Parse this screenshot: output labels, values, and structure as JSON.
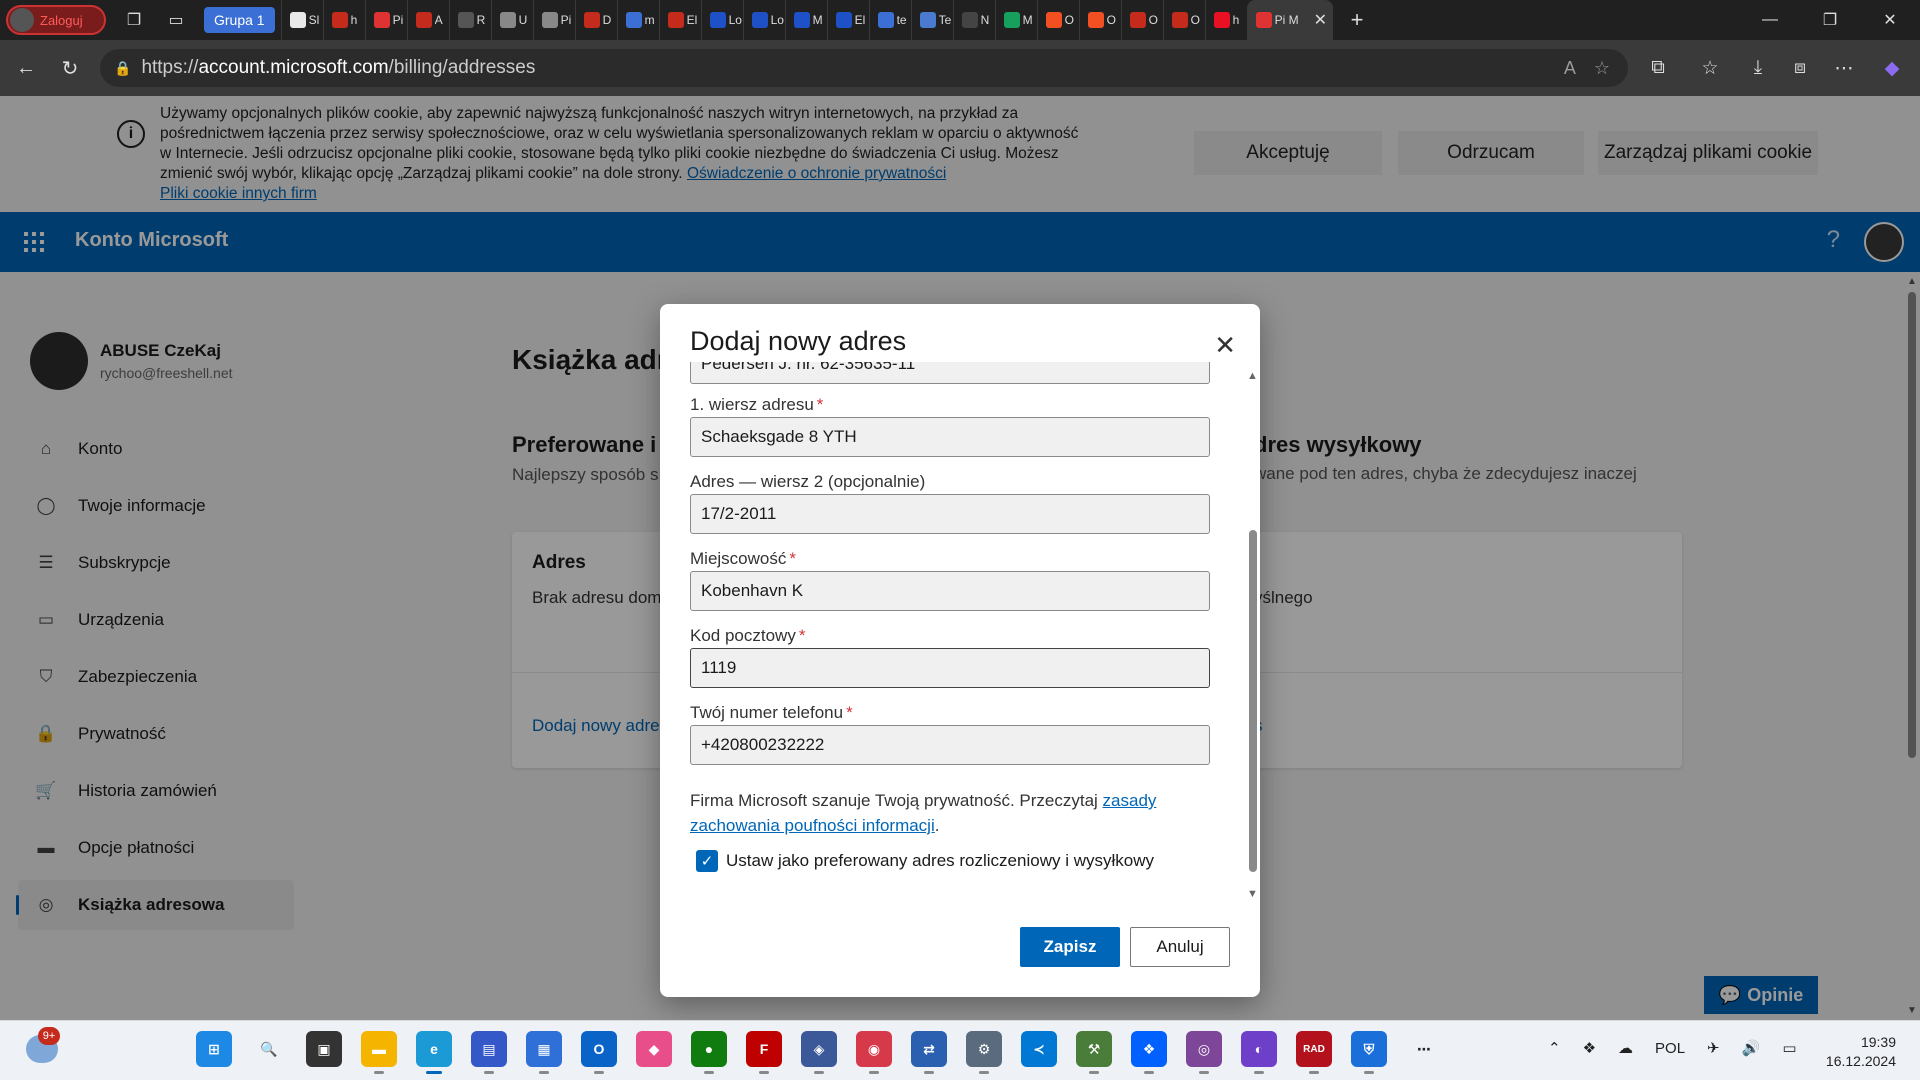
{
  "browser": {
    "profile_label": "Zaloguj",
    "group_label": "Grupa 1",
    "tabs": [
      {
        "title": "Sl",
        "color": "#e8e8e8"
      },
      {
        "title": "h",
        "color": "#c42b1c"
      },
      {
        "title": "Pi",
        "color": "#d33"
      },
      {
        "title": "A",
        "color": "#c42b1c"
      },
      {
        "title": "R",
        "color": "#555"
      },
      {
        "title": "U",
        "color": "#888"
      },
      {
        "title": "Pi",
        "color": "#888"
      },
      {
        "title": "D",
        "color": "#c42b1c"
      },
      {
        "title": "m",
        "color": "#3b6fd6"
      },
      {
        "title": "El",
        "color": "#c42b1c"
      },
      {
        "title": "Lo",
        "color": "#1e50c8"
      },
      {
        "title": "Lo",
        "color": "#1e50c8"
      },
      {
        "title": "M",
        "color": "#1e50c8"
      },
      {
        "title": "El",
        "color": "#1e50c8"
      },
      {
        "title": "te",
        "color": "#3b6fd6"
      },
      {
        "title": "Te",
        "color": "#4a7bd0"
      },
      {
        "title": "N",
        "color": "#444"
      },
      {
        "title": "M",
        "color": "#17a05d"
      },
      {
        "title": "O",
        "color": "#f25022"
      },
      {
        "title": "O",
        "color": "#f25022"
      },
      {
        "title": "O",
        "color": "#c42b1c"
      },
      {
        "title": "O",
        "color": "#c42b1c"
      },
      {
        "title": "h",
        "color": "#e81123"
      }
    ],
    "active_tab_title": "Pi M",
    "url_prefix": "https://",
    "url_host": "account.microsoft.com",
    "url_path": "/billing/addresses"
  },
  "cookie_banner": {
    "text": "Używamy opcjonalnych plików cookie, aby zapewnić najwyższą funkcjonalność naszych witryn internetowych, na przykład za pośrednictwem łączenia przez serwisy społecznościowe, oraz w celu wyświetlania spersonalizowanych reklam w oparciu o aktywność w Internecie. Jeśli odrzucisz opcjonalne pliki cookie, stosowane będą tylko pliki cookie niezbędne do świadczenia Ci usług. Możesz zmienić swój wybór, klikając opcję „Zarządzaj plikami cookie” na dole strony.",
    "privacy_link": "Oświadczenie o ochronie prywatności",
    "third_party_link": "Pliki cookie innych firm",
    "accept_label": "Akceptuję",
    "reject_label": "Odrzucam",
    "manage_label": "Zarządzaj plikami cookie"
  },
  "header": {
    "brand": "Konto Microsoft",
    "help": "?"
  },
  "user": {
    "name": "ABUSE CzeKaj",
    "email": "rychoo@freeshell.net"
  },
  "sidebar": {
    "items": [
      {
        "label": "Konto",
        "icon": "home-icon"
      },
      {
        "label": "Twoje informacje",
        "icon": "person-icon"
      },
      {
        "label": "Subskrypcje",
        "icon": "subscriptions-icon"
      },
      {
        "label": "Urządzenia",
        "icon": "devices-icon"
      },
      {
        "label": "Zabezpieczenia",
        "icon": "shield-icon"
      },
      {
        "label": "Prywatność",
        "icon": "lock-icon"
      },
      {
        "label": "Historia zamówień",
        "icon": "cart-icon"
      },
      {
        "label": "Opcje płatności",
        "icon": "card-icon"
      },
      {
        "label": "Książka adresowa",
        "icon": "location-icon"
      }
    ]
  },
  "main": {
    "title": "Książka adresowa",
    "left_section_title": "Preferowane i",
    "left_section_desc": "Najlepszy sposób s rozliczeniowych",
    "right_section_title": "dres wysyłkowy",
    "right_section_desc": "wane pod ten adres, chyba że zdecydujesz inaczej",
    "left_card_title": "Adres",
    "left_card_text": "Brak adresu dom",
    "left_card_link": "Dodaj nowy adre",
    "right_card_text": "yślnego",
    "right_card_link": "s",
    "feedback_label": "Opinie"
  },
  "dialog": {
    "title": "Dodaj nowy adres",
    "fields": {
      "name_value": "Pedersen J. nr. 62-35635-11",
      "address1_label": "1. wiersz adresu",
      "address1_value": "Schaeksgade 8 YTH",
      "address2_label": "Adres — wiersz 2 (opcjonalnie)",
      "address2_value": "17/2-2011",
      "city_label": "Miejscowość",
      "city_value": "Kobenhavn K",
      "postal_label": "Kod pocztowy",
      "postal_value": "1119",
      "phone_label": "Twój numer telefonu",
      "phone_value": "+420800232222"
    },
    "required_mark": "*",
    "privacy_text": "Firma Microsoft szanuje Twoją prywatność. Przeczytaj ",
    "privacy_link": "zasady zachowania poufności informacji",
    "privacy_end": ".",
    "checkbox_label": "Ustaw jako preferowany adres rozliczeniowy i wysyłkowy",
    "checkbox_checked": true,
    "save_label": "Zapisz",
    "cancel_label": "Anuluj"
  },
  "taskbar": {
    "weather_badge": "9+",
    "apps": [
      {
        "name": "windows-start-icon",
        "color": "#1e88e5",
        "glyph": "⊞"
      },
      {
        "name": "search-icon",
        "color": "transparent",
        "glyph": "🔍"
      },
      {
        "name": "task-view-icon",
        "color": "#333",
        "glyph": "▣"
      },
      {
        "name": "file-explorer-icon",
        "color": "#f4b400",
        "glyph": "▬"
      },
      {
        "name": "edge-icon",
        "color": "#1c9ad6",
        "glyph": "e"
      },
      {
        "name": "save-app-icon",
        "color": "#3558c8",
        "glyph": "▤"
      },
      {
        "name": "store-icon",
        "color": "#2f6fd8",
        "glyph": "▦"
      },
      {
        "name": "outlook-icon",
        "color": "#0a64c8",
        "glyph": "O"
      },
      {
        "name": "gem-icon",
        "color": "#e84e89",
        "glyph": "◆"
      },
      {
        "name": "xbox-icon",
        "color": "#107c10",
        "glyph": "●"
      },
      {
        "name": "filezilla-icon",
        "color": "#bf0000",
        "glyph": "F"
      },
      {
        "name": "cube-icon",
        "color": "#3b5998",
        "glyph": "◈"
      },
      {
        "name": "screen-app-icon",
        "color": "#d63a4a",
        "glyph": "◉"
      },
      {
        "name": "network-app-icon",
        "color": "#2b5fb0",
        "glyph": "⇄"
      },
      {
        "name": "settings-icon",
        "color": "#5a6b7d",
        "glyph": "⚙"
      },
      {
        "name": "vscode-icon",
        "color": "#0078d4",
        "glyph": "≺"
      },
      {
        "name": "tools-app-icon",
        "color": "#4a7c3a",
        "glyph": "⚒"
      },
      {
        "name": "dropbox-icon",
        "color": "#0061ff",
        "glyph": "❖"
      },
      {
        "name": "tor-icon",
        "color": "#7d4698",
        "glyph": "◎"
      },
      {
        "name": "github-desktop-icon",
        "color": "#6e40c9",
        "glyph": "◐"
      },
      {
        "name": "rad-icon",
        "color": "#b3121d",
        "glyph": "RAD"
      },
      {
        "name": "defender-icon",
        "color": "#1a6fd8",
        "glyph": "⛨"
      },
      {
        "name": "more-apps-icon",
        "color": "transparent",
        "glyph": "⋯"
      }
    ],
    "lang": "POL",
    "time": "19:39",
    "date": "16.12.2024"
  }
}
